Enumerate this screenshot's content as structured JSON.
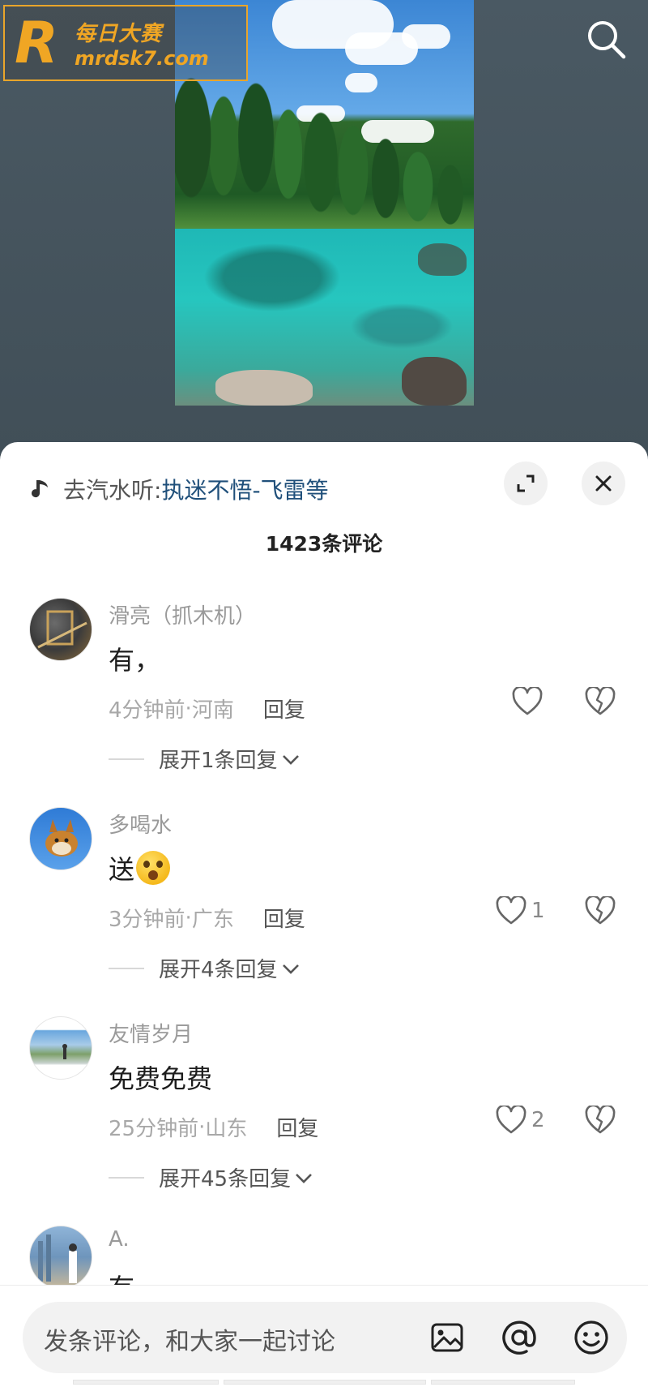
{
  "watermark": {
    "logo_letter": "R",
    "name": "每日大赛",
    "site": "mrdsk7.com"
  },
  "header": {
    "search_icon": "search-icon"
  },
  "sheet": {
    "music_prefix": "去汽水听: ",
    "music_title": "执迷不悟-飞雷等",
    "comment_count_title": "1423条评论",
    "expand_icon": "expand-icon",
    "close_icon": "close-icon"
  },
  "comments": [
    {
      "username": "滑亮（抓木机）",
      "content": "有，",
      "time": "4分钟前",
      "location": "河南",
      "separator": " · ",
      "reply_label": "回复",
      "likes": "",
      "expand_label": "展开1条回复"
    },
    {
      "username": "多喝水",
      "content": "送",
      "emoji": "😲",
      "time": "3分钟前",
      "location": "广东",
      "separator": " · ",
      "reply_label": "回复",
      "likes": "1",
      "expand_label": "展开4条回复"
    },
    {
      "username": "友情岁月",
      "content": "免费免费",
      "time": "25分钟前",
      "location": "山东",
      "separator": " · ",
      "reply_label": "回复",
      "likes": "2",
      "expand_label": "展开45条回复"
    },
    {
      "username": "A.",
      "content": "有"
    }
  ],
  "input_bar": {
    "placeholder": "发条评论，和大家一起讨论",
    "icons": [
      "image-icon",
      "at-icon",
      "emoji-icon"
    ]
  },
  "colors": {
    "accent_link": "#1f4f7a",
    "watermark": "#f0a624",
    "background_top": "#414f58"
  }
}
